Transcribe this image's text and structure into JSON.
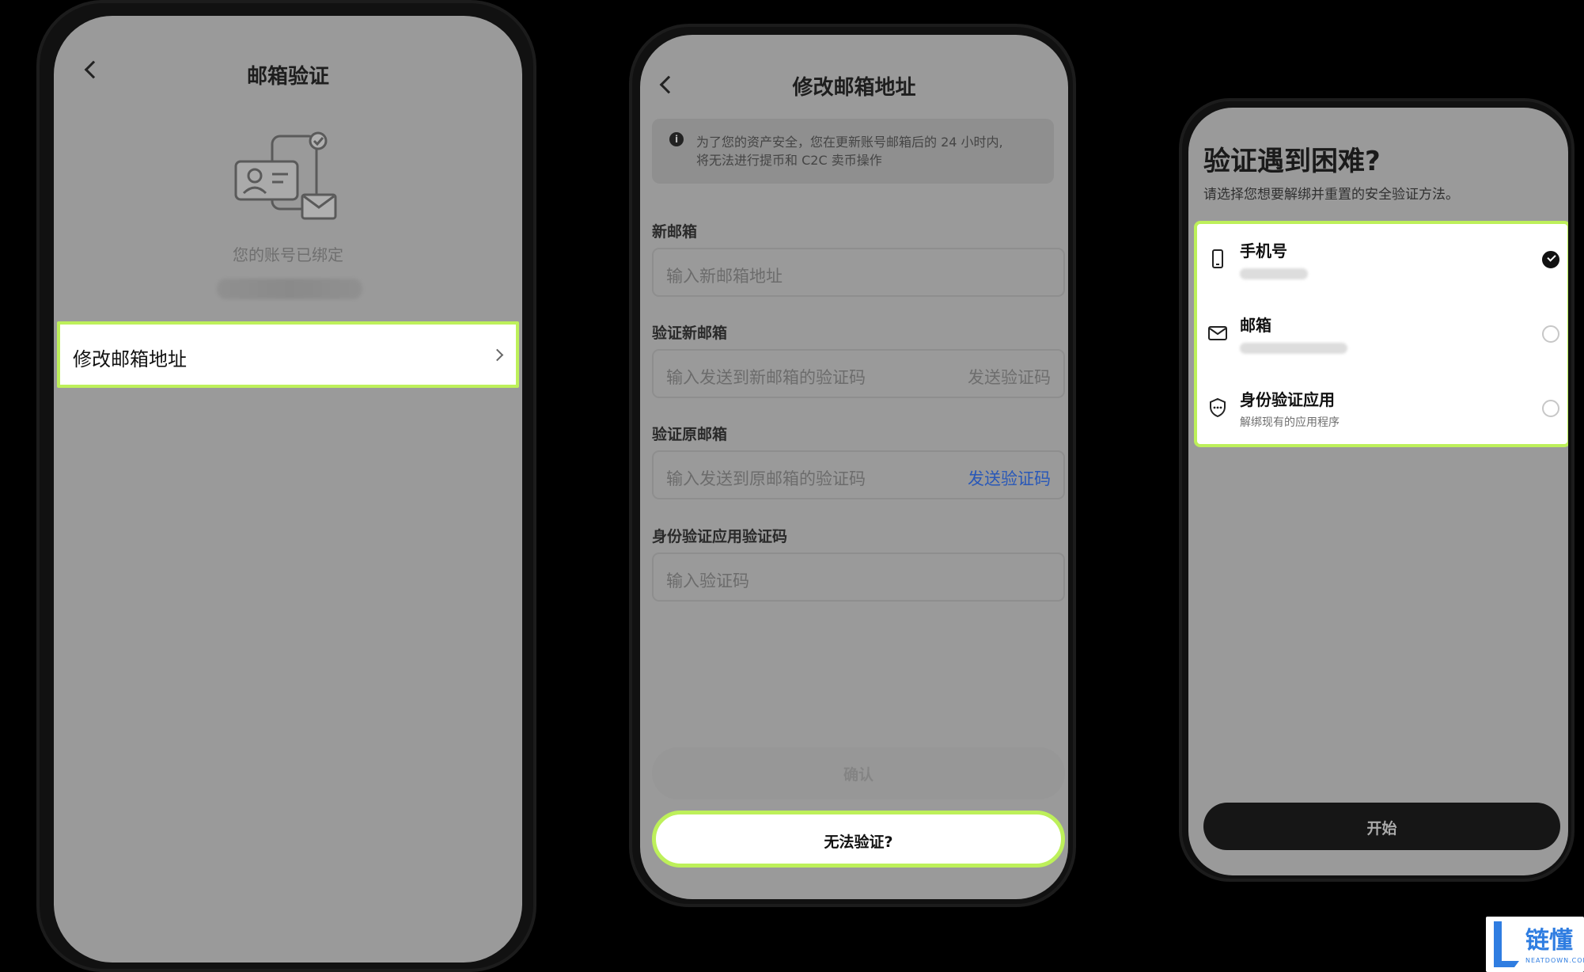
{
  "screens": {
    "email_verification": {
      "title": "邮箱验证",
      "bound_text": "您的账号已绑定",
      "row_label": "修改邮箱地址"
    },
    "change_email": {
      "title": "修改邮箱地址",
      "notice": [
        "为了您的资产安全，您在更新账号邮箱后的 24 小时内,",
        "将无法进行提币和 C2C 卖币操作"
      ],
      "fields": [
        {
          "label": "新邮箱",
          "placeholder": "输入新邮箱地址"
        },
        {
          "label": "验证新邮箱",
          "placeholder": "输入发送到新邮箱的验证码",
          "action": "发送验证码"
        },
        {
          "label": "验证原邮箱",
          "placeholder": "输入发送到原邮箱的验证码",
          "action": "发送验证码"
        },
        {
          "label": "身份验证应用验证码",
          "placeholder": "输入验证码"
        }
      ],
      "confirm_label": "确认",
      "cannot_verify_label": "无法验证?"
    },
    "verification_difficulty": {
      "title": "验证遇到困难?",
      "subtitle": "请选择您想要解绑并重置的安全验证方法。",
      "options": [
        {
          "label": "手机号",
          "selected": true,
          "icon": "phone-icon"
        },
        {
          "label": "邮箱",
          "selected": false,
          "icon": "mail-icon"
        },
        {
          "label": "身份验证应用",
          "subtext": "解绑现有的应用程序",
          "selected": false,
          "icon": "shield-icon"
        }
      ],
      "start_label": "开始"
    }
  },
  "watermark": {
    "brand": "链懂",
    "domain": "NEATDOWN.COM"
  },
  "colors": {
    "highlight": "#bdf05a",
    "link": "#2958b8",
    "overlay": "#9a9a9a"
  }
}
